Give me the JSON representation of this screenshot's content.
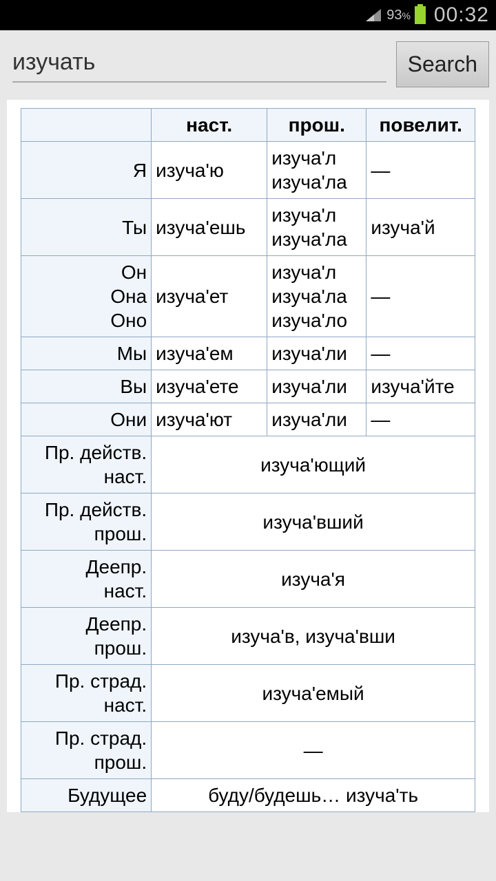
{
  "status": {
    "battery_pct": "93",
    "battery_pct_suffix": "%",
    "time": "00:32"
  },
  "search": {
    "value": "изучать",
    "button": "Search"
  },
  "headers": {
    "c1": "",
    "c2": "наст.",
    "c3": "прош.",
    "c4": "повелит."
  },
  "rows": [
    {
      "pronoun": "Я",
      "present": "изуча'ю",
      "past": "изуча'л\nизуча'ла",
      "imperative": "—"
    },
    {
      "pronoun": "Ты",
      "present": "изуча'ешь",
      "past": "изуча'л\nизуча'ла",
      "imperative": "изуча'й"
    },
    {
      "pronoun": "Он\nОна\nОно",
      "present": "изуча'ет",
      "past": "изуча'л\nизуча'ла\nизуча'ло",
      "imperative": "—"
    },
    {
      "pronoun": "Мы",
      "present": "изуча'ем",
      "past": "изуча'ли",
      "imperative": "—"
    },
    {
      "pronoun": "Вы",
      "present": "изуча'ете",
      "past": "изуча'ли",
      "imperative": "изуча'йте"
    },
    {
      "pronoun": "Они",
      "present": "изуча'ют",
      "past": "изуча'ли",
      "imperative": "—"
    }
  ],
  "forms": [
    {
      "label": "Пр. действ.\nнаст.",
      "value": "изуча'ющий"
    },
    {
      "label": "Пр. действ.\nпрош.",
      "value": "изуча'вший"
    },
    {
      "label": "Деепр.\nнаст.",
      "value": "изуча'я"
    },
    {
      "label": "Деепр.\nпрош.",
      "value": "изуча'в, изуча'вши"
    },
    {
      "label": "Пр. страд.\nнаст.",
      "value": "изуча'емый"
    },
    {
      "label": "Пр. страд.\nпрош.",
      "value": "—"
    },
    {
      "label": "Будущее",
      "value": "буду/будешь… изуча'ть"
    }
  ]
}
